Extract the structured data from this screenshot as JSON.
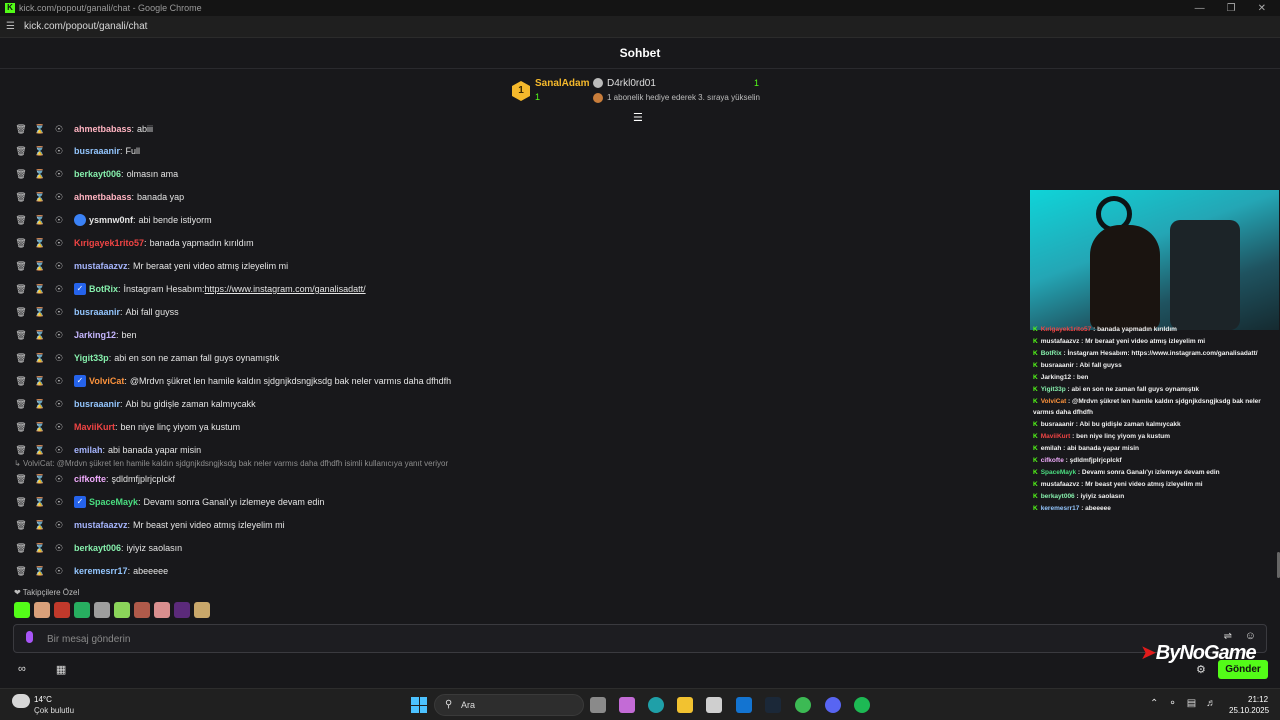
{
  "browser": {
    "window_title": "kick.com/popout/ganali/chat - Google Chrome",
    "url": "kick.com/popout/ganali/chat"
  },
  "chat": {
    "title": "Sohbet",
    "pinned": {
      "rank": "1",
      "user1": "SanalAdam",
      "user1_count": "1",
      "user2": "D4rkl0rd01",
      "user2_count": "1",
      "hint": "1 abonelik hediye ederek 3. sıraya yükselin"
    },
    "messages": [
      {
        "user": "ahmetbabass",
        "color": "#ffb3c1",
        "text": "abiii"
      },
      {
        "user": "busraaanir",
        "color": "#93c5fd",
        "text": "Full"
      },
      {
        "user": "berkayt006",
        "color": "#86efac",
        "text": "olmasın ama"
      },
      {
        "user": "ahmetbabass",
        "color": "#ffb3c1",
        "text": "banada yap"
      },
      {
        "user": "ysmnw0nf",
        "color": "#e5e5e5",
        "text": "abi bende istiyorm"
      },
      {
        "user": "Kırigayek1rito57",
        "color": "#ef4444",
        "text": "banada yapmadın kırıldım"
      },
      {
        "user": "mustafaazvz",
        "color": "#a5b4fc",
        "text": "Mr beraat yeni video atmış izleyelim mi"
      },
      {
        "user": "BotRix",
        "color": "#86efac",
        "text": "İnstagram Hesabım: ",
        "link": "https://www.instagram.com/ganalisadatt/"
      },
      {
        "user": "busraaanir",
        "color": "#93c5fd",
        "text": "Abi fall guyss"
      },
      {
        "user": "Jarking12",
        "color": "#c4b5fd",
        "text": "ben"
      },
      {
        "user": "Yigit33p",
        "color": "#86efac",
        "text": "abi en son ne zaman fall guys oynamıştık"
      },
      {
        "user": "VolviCat",
        "color": "#fb923c",
        "text": "@Mrdvn şükret len hamile kaldın sjdgnjkdsngjksdg bak neler varmıs daha dfhdfh"
      },
      {
        "user": "busraaanir",
        "color": "#93c5fd",
        "text": "Abi bu gidişle zaman kalmıycakk"
      },
      {
        "user": "MaviiKurt",
        "color": "#ef4444",
        "text": "ben niye linç yiyom ya kustum"
      },
      {
        "user": "emilah",
        "color": "#a5b4fc",
        "text": "abi banada yapar misin"
      },
      {
        "user": "cifkofte",
        "color": "#f0abfc",
        "text": "şdldmfjplrjcplckf"
      },
      {
        "user": "SpaceMayk",
        "color": "#4ade80",
        "text": "Devamı sonra Ganalı'yı izlemeye devam edin"
      },
      {
        "user": "mustafaazvz",
        "color": "#a5b4fc",
        "text": "Mr beast yeni video atmış izleyelim mi"
      },
      {
        "user": "berkayt006",
        "color": "#86efac",
        "text": "iyiyiz saolasın"
      },
      {
        "user": "keremesrr17",
        "color": "#93c5fd",
        "text": "abeeeee"
      }
    ],
    "reply_notice": "VolviCat: @Mrdvn şükret len hamile kaldın sjdgnjkdsngjksdg bak neler varmıs daha dfhdfh isimli kullanıcıya yanıt veriyor",
    "followers_label": "Takipçilere Özel",
    "input_placeholder": "Bir mesaj gönderin",
    "send_label": "Gönder"
  },
  "overlay": {
    "watermark": "ByNoGame",
    "lines": [
      {
        "user": "Kırigayek1rito57",
        "color": "#ef4444",
        "text": "banada yapmadın kırıldım"
      },
      {
        "user": "mustafaazvz",
        "color": "#f1f1f1",
        "text": "Mr beraat yeni video atmış izleyelim mi"
      },
      {
        "user": "BotRix",
        "color": "#86efac",
        "text": "İnstagram Hesabım: https://www.instagram.com/ganalisadatt/"
      },
      {
        "user": "busraaanir",
        "color": "#f1f1f1",
        "text": "Abi fall guyss"
      },
      {
        "user": "Jarking12",
        "color": "#f1f1f1",
        "text": "ben"
      },
      {
        "user": "Yigit33p",
        "color": "#86efac",
        "text": "abi en son ne zaman fall guys oynamıştık"
      },
      {
        "user": "VolviCat",
        "color": "#fb923c",
        "text": "@Mrdvn şükret len hamile kaldın sjdgnjkdsngjksdg bak neler"
      },
      {
        "user": "",
        "color": "#f1f1f1",
        "text": "varmıs daha dfhdfh"
      },
      {
        "user": "busraaanir",
        "color": "#f1f1f1",
        "text": "Abi bu gidişle zaman kalmıycakk"
      },
      {
        "user": "MaviiKurt",
        "color": "#ef4444",
        "text": "ben niye linç yiyom ya kustum"
      },
      {
        "user": "emilah",
        "color": "#f1f1f1",
        "text": "abi banada yapar misin"
      },
      {
        "user": "cifkofte",
        "color": "#f0abfc",
        "text": "şdldmfjplrjcplckf"
      },
      {
        "user": "SpaceMayk",
        "color": "#4ade80",
        "text": "Devamı sonra Ganalı'yı izlemeye devam edin"
      },
      {
        "user": "mustafaazvz",
        "color": "#f1f1f1",
        "text": "Mr beast yeni video atmış izleyelim mi"
      },
      {
        "user": "berkayt006",
        "color": "#86efac",
        "text": "iyiyiz saolasın"
      },
      {
        "user": "keremesrr17",
        "color": "#93c5fd",
        "text": "abeeeee"
      }
    ]
  },
  "taskbar": {
    "temperature": "14°C",
    "weather": "Çok bulutlu",
    "search_label": "Ara",
    "time": "21:12",
    "date": "25.10.2025"
  }
}
